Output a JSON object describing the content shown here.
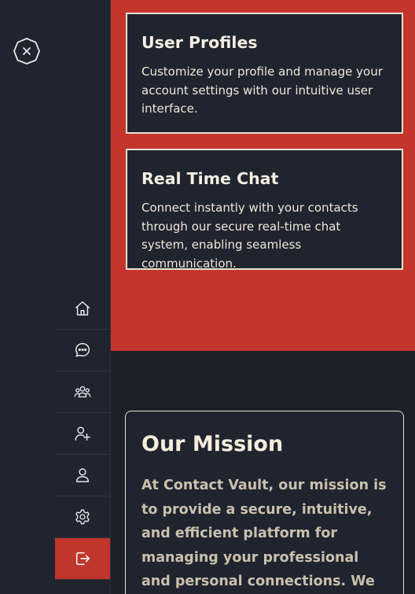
{
  "sidebar": {
    "close_icon": "close-icon",
    "nav_items": [
      {
        "name": "home",
        "icon": "home-icon"
      },
      {
        "name": "chat",
        "icon": "chat-bubble-icon"
      },
      {
        "name": "contacts",
        "icon": "group-icon"
      },
      {
        "name": "add-contact",
        "icon": "user-plus-icon"
      },
      {
        "name": "profile",
        "icon": "user-icon"
      },
      {
        "name": "settings",
        "icon": "gear-icon"
      },
      {
        "name": "logout",
        "icon": "logout-icon",
        "active": true
      }
    ]
  },
  "features": [
    {
      "title": "User Profiles",
      "description": "Customize your profile and manage your account settings with our intuitive user interface."
    },
    {
      "title": "Real Time Chat",
      "description": "Connect instantly with your contacts through our secure real-time chat system, enabling seamless communication."
    }
  ],
  "mission": {
    "title": "Our Mission",
    "text": "At Contact Vault, our mission is to provide a secure, intuitive, and efficient platform for managing your professional and personal connections. We"
  },
  "colors": {
    "accent_red": "#c4352d",
    "sidebar_bg": "#20242f",
    "page_bg": "#1d2029",
    "card_border": "#e8e2d2"
  }
}
